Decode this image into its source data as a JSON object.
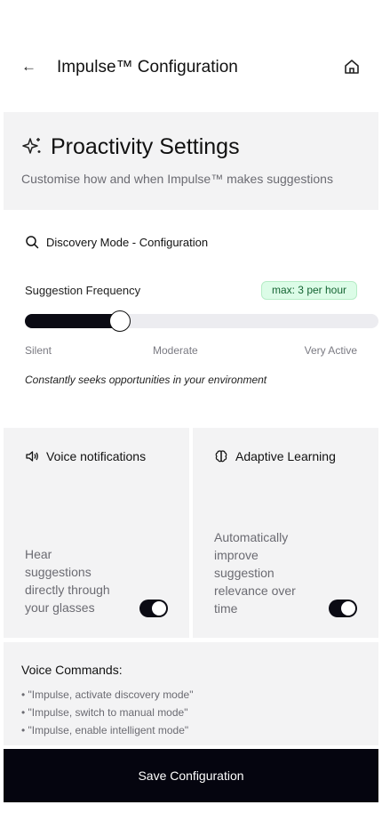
{
  "header": {
    "back_icon": "arrow-left-icon",
    "title": "Impulse™ Configuration",
    "home_icon": "home-icon"
  },
  "hero": {
    "icon": "sparkles-icon",
    "title": "Proactivity Settings",
    "subtitle": "Customise how and when Impulse™ makes suggestions"
  },
  "discovery": {
    "icon": "search-icon",
    "title": "Discovery Mode - Configuration",
    "frequency_label": "Suggestion Frequency",
    "badge": "max: 3 per hour",
    "slider_value": 0.27,
    "ticks": [
      "Silent",
      "Moderate",
      "Very Active"
    ],
    "description": "Constantly seeks opportunities in your environment"
  },
  "cards": [
    {
      "icon": "speaker-icon",
      "title": "Voice notifications",
      "desc_lines": [
        "Hear",
        "suggestions",
        "directly through",
        "your glasses"
      ],
      "toggle_on": true
    },
    {
      "icon": "brain-icon",
      "title": "Adaptive Learning",
      "desc_lines": [
        "Automatically",
        "improve",
        "suggestion",
        "relevance over",
        "time"
      ],
      "toggle_on": true
    }
  ],
  "commands": {
    "title": "Voice Commands:",
    "items": [
      "• \"Impulse, activate discovery mode\"",
      "• \"Impulse, switch to manual mode\"",
      "• \"Impulse, enable intelligent mode\""
    ]
  },
  "save_label": "Save Configuration",
  "colors": {
    "accent": "#0b0b14",
    "badge_bg": "#dcfce7",
    "badge_text": "#166534",
    "panel_bg": "#f3f3f4"
  }
}
